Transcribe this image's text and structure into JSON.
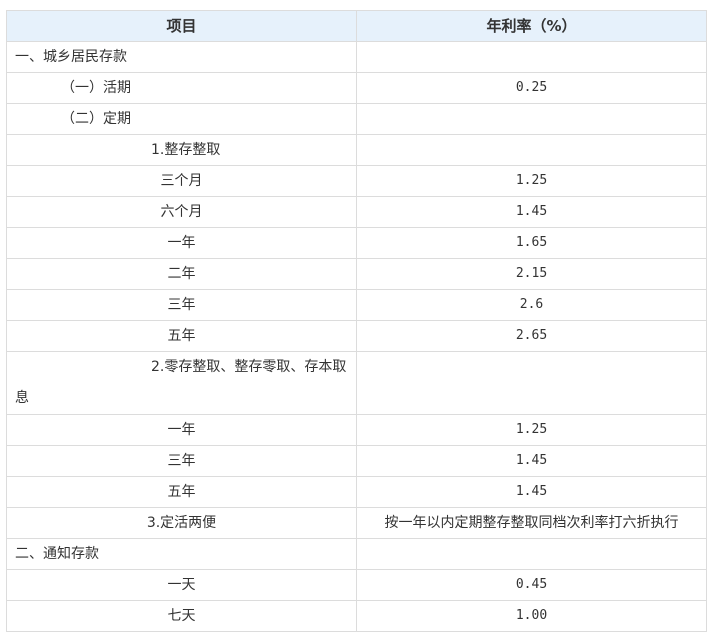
{
  "header": {
    "item": "项目",
    "rate": "年利率（%）"
  },
  "rows": [
    {
      "label": "一、城乡居民存款",
      "rate": "",
      "style": "section"
    },
    {
      "label": "（一）活期",
      "rate": "0.25",
      "style": "ind1"
    },
    {
      "label": "（二）定期",
      "rate": "",
      "style": "ind1"
    },
    {
      "label": "1.整存整取",
      "rate": "",
      "style": "ind2"
    },
    {
      "label": "三个月",
      "rate": "1.25",
      "style": "center"
    },
    {
      "label": "六个月",
      "rate": "1.45",
      "style": "center"
    },
    {
      "label": "一年",
      "rate": "1.65",
      "style": "center"
    },
    {
      "label": "二年",
      "rate": "2.15",
      "style": "center"
    },
    {
      "label": "三年",
      "rate": "2.6",
      "style": "center"
    },
    {
      "label": "五年",
      "rate": "2.65",
      "style": "center"
    },
    {
      "label": "2.零存整取、整存零取、存本取息",
      "rate": "",
      "style": "ind2 wrap"
    },
    {
      "label": "一年",
      "rate": "1.25",
      "style": "center"
    },
    {
      "label": "三年",
      "rate": "1.45",
      "style": "center"
    },
    {
      "label": "五年",
      "rate": "1.45",
      "style": "center"
    },
    {
      "label": "3.定活两便",
      "rate": "按一年以内定期整存整取同档次利率打六折执行",
      "style": "center"
    },
    {
      "label": "二、通知存款",
      "rate": "",
      "style": "section"
    },
    {
      "label": "一天",
      "rate": "0.45",
      "style": "center"
    },
    {
      "label": "七天",
      "rate": "1.00",
      "style": "center"
    }
  ]
}
